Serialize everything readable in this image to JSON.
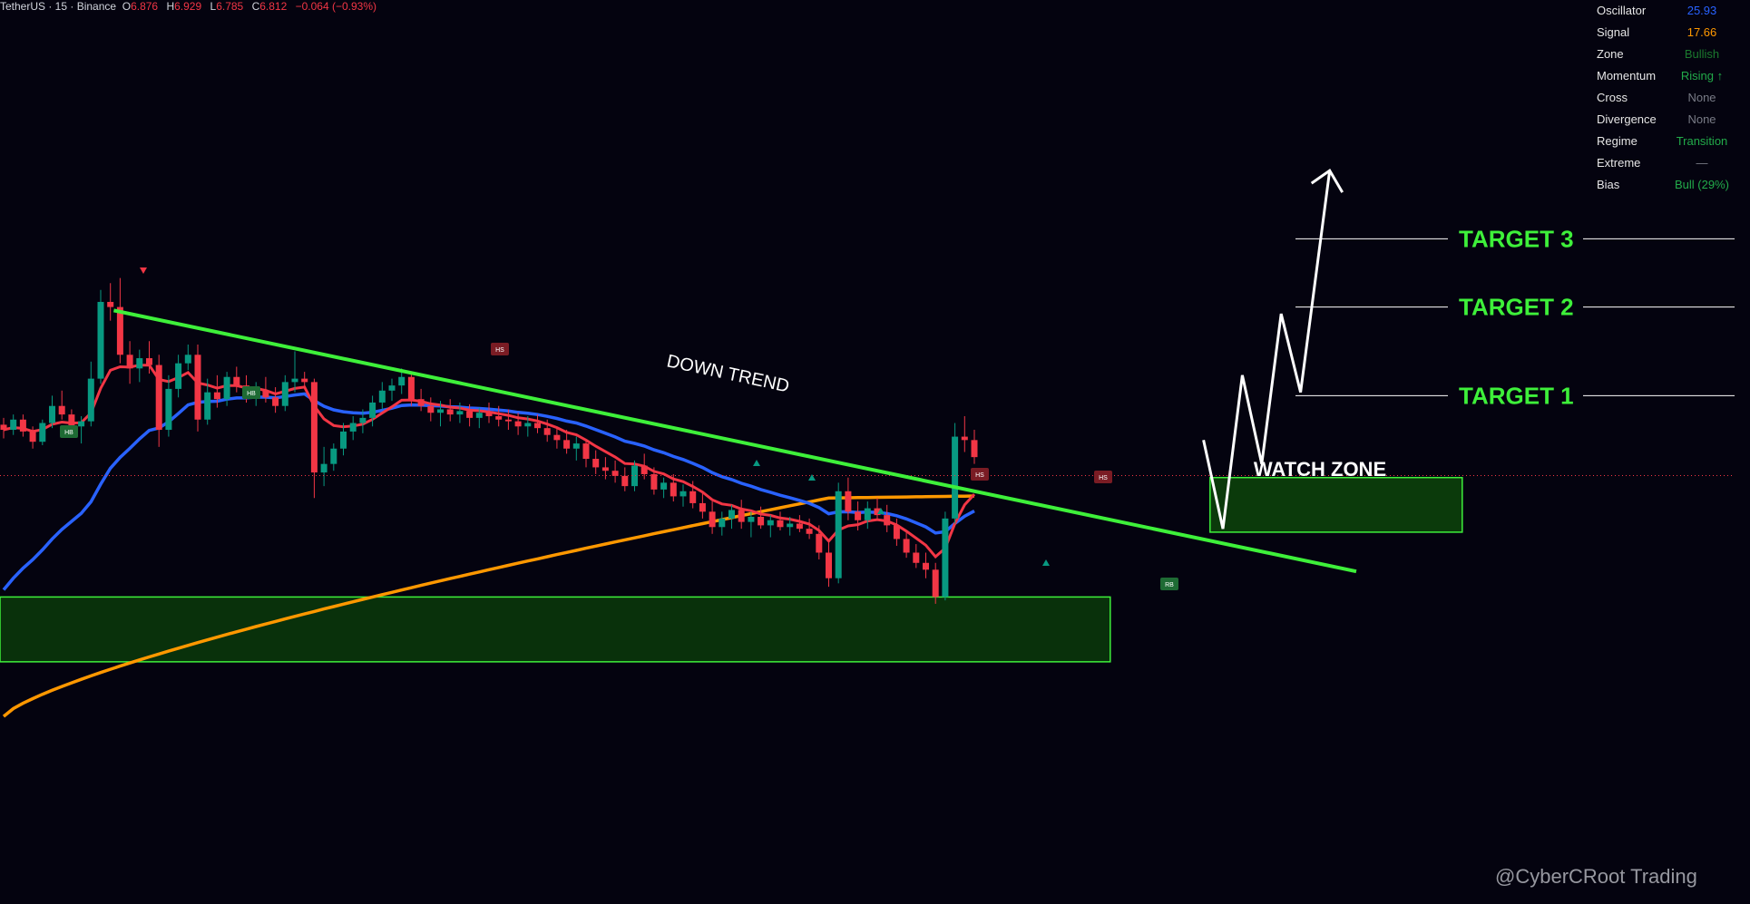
{
  "header": {
    "symbol": "TetherUS · 15 · Binance",
    "open_label": "O",
    "open": "6.876",
    "high_label": "H",
    "high": "6.929",
    "low_label": "L",
    "low": "6.785",
    "close_label": "C",
    "close": "6.812",
    "change": "−0.064 (−0.93%)"
  },
  "panel": [
    {
      "label": "Oscillator",
      "value": "25.93",
      "color": "#2962ff"
    },
    {
      "label": "Signal",
      "value": "17.66",
      "color": "#ff9800"
    },
    {
      "label": "Zone",
      "value": "Bullish",
      "color": "#1b7a2e"
    },
    {
      "label": "Momentum",
      "value": "Rising ↑",
      "color": "#22ab4a"
    },
    {
      "label": "Cross",
      "value": "None",
      "color": "#787b86"
    },
    {
      "label": "Divergence",
      "value": "None",
      "color": "#787b86"
    },
    {
      "label": "Regime",
      "value": "Transition",
      "color": "#22ab4a"
    },
    {
      "label": "Extreme",
      "value": "—",
      "color": "#787b86"
    },
    {
      "label": "Bias",
      "value": "Bull (29%)",
      "color": "#22ab4a"
    }
  ],
  "annotations": {
    "trend_label": "DOWN TREND",
    "watch_zone": "WATCH ZONE",
    "target_1": "TARGET 1",
    "target_2": "TARGET 2",
    "target_3": "TARGET 3",
    "hs_marker": "HS",
    "hb_marker": "HB",
    "rb_marker": "RB"
  },
  "watermark": "@CyberCRoot Trading",
  "colors": {
    "bg": "#04030f",
    "bull": "#089981",
    "bear": "#f23645",
    "trendline": "#3ef03a",
    "zone_fill": "#0b3a0b",
    "zone_border": "#3ef03a",
    "target_text": "#3ef03a",
    "ema_fast": "#f23645",
    "ema_mid": "#2962ff",
    "ema_slow": "#ff9800",
    "projection": "#ffffff"
  },
  "chart_data": {
    "type": "candlestick",
    "timeframe": "15",
    "exchange": "Binance",
    "ylim": [
      4.3,
      9.6
    ],
    "current_price": 6.812,
    "ohlc": [
      [
        7.11,
        7.15,
        7.03,
        7.08
      ],
      [
        7.08,
        7.17,
        7.05,
        7.14
      ],
      [
        7.14,
        7.17,
        7.04,
        7.07
      ],
      [
        7.07,
        7.1,
        6.97,
        7.01
      ],
      [
        7.01,
        7.14,
        6.99,
        7.12
      ],
      [
        7.12,
        7.28,
        7.09,
        7.22
      ],
      [
        7.22,
        7.31,
        7.14,
        7.17
      ],
      [
        7.17,
        7.2,
        7.07,
        7.1
      ],
      [
        7.1,
        7.16,
        7.0,
        7.13
      ],
      [
        7.13,
        7.48,
        7.1,
        7.38
      ],
      [
        7.38,
        7.9,
        7.35,
        7.83
      ],
      [
        7.83,
        7.94,
        7.72,
        7.8
      ],
      [
        7.8,
        7.97,
        7.47,
        7.52
      ],
      [
        7.52,
        7.6,
        7.35,
        7.44
      ],
      [
        7.44,
        7.55,
        7.36,
        7.5
      ],
      [
        7.5,
        7.6,
        7.41,
        7.46
      ],
      [
        7.46,
        7.52,
        6.98,
        7.08
      ],
      [
        7.08,
        7.4,
        7.04,
        7.32
      ],
      [
        7.32,
        7.52,
        7.27,
        7.47
      ],
      [
        7.47,
        7.58,
        7.43,
        7.52
      ],
      [
        7.52,
        7.58,
        7.07,
        7.14
      ],
      [
        7.14,
        7.38,
        7.11,
        7.3
      ],
      [
        7.3,
        7.4,
        7.21,
        7.26
      ],
      [
        7.26,
        7.42,
        7.22,
        7.39
      ],
      [
        7.39,
        7.45,
        7.3,
        7.34
      ],
      [
        7.34,
        7.4,
        7.24,
        7.28
      ],
      [
        7.28,
        7.36,
        7.22,
        7.31
      ],
      [
        7.31,
        7.39,
        7.24,
        7.27
      ],
      [
        7.27,
        7.33,
        7.18,
        7.22
      ],
      [
        7.22,
        7.4,
        7.19,
        7.36
      ],
      [
        7.36,
        7.54,
        7.3,
        7.38
      ],
      [
        7.38,
        7.42,
        7.33,
        7.36
      ],
      [
        7.36,
        7.38,
        6.68,
        6.83
      ],
      [
        6.83,
        6.98,
        6.75,
        6.88
      ],
      [
        6.88,
        7.0,
        6.84,
        6.97
      ],
      [
        6.97,
        7.12,
        6.93,
        7.07
      ],
      [
        7.07,
        7.16,
        7.02,
        7.12
      ],
      [
        7.12,
        7.2,
        7.06,
        7.15
      ],
      [
        7.15,
        7.28,
        7.1,
        7.24
      ],
      [
        7.24,
        7.36,
        7.2,
        7.31
      ],
      [
        7.31,
        7.38,
        7.25,
        7.34
      ],
      [
        7.34,
        7.44,
        7.29,
        7.39
      ],
      [
        7.39,
        7.42,
        7.22,
        7.26
      ],
      [
        7.26,
        7.32,
        7.19,
        7.22
      ],
      [
        7.22,
        7.27,
        7.13,
        7.18
      ],
      [
        7.18,
        7.25,
        7.1,
        7.2
      ],
      [
        7.2,
        7.26,
        7.13,
        7.17
      ],
      [
        7.17,
        7.24,
        7.12,
        7.19
      ],
      [
        7.19,
        7.23,
        7.1,
        7.15
      ],
      [
        7.15,
        7.21,
        7.09,
        7.18
      ],
      [
        7.18,
        7.24,
        7.12,
        7.16
      ],
      [
        7.16,
        7.22,
        7.1,
        7.14
      ],
      [
        7.14,
        7.2,
        7.08,
        7.13
      ],
      [
        7.13,
        7.18,
        7.05,
        7.1
      ],
      [
        7.1,
        7.16,
        7.04,
        7.12
      ],
      [
        7.12,
        7.17,
        7.06,
        7.09
      ],
      [
        7.09,
        7.14,
        7.01,
        7.05
      ],
      [
        7.05,
        7.1,
        6.97,
        7.02
      ],
      [
        7.02,
        7.08,
        6.94,
        6.97
      ],
      [
        6.97,
        7.04,
        6.9,
        7.0
      ],
      [
        7.0,
        7.02,
        6.86,
        6.91
      ],
      [
        6.91,
        6.96,
        6.82,
        6.86
      ],
      [
        6.86,
        6.92,
        6.79,
        6.84
      ],
      [
        6.84,
        6.9,
        6.77,
        6.81
      ],
      [
        6.81,
        6.86,
        6.72,
        6.75
      ],
      [
        6.75,
        6.9,
        6.72,
        6.87
      ],
      [
        6.87,
        6.94,
        6.79,
        6.82
      ],
      [
        6.82,
        6.86,
        6.7,
        6.73
      ],
      [
        6.73,
        6.8,
        6.68,
        6.77
      ],
      [
        6.77,
        6.82,
        6.66,
        6.69
      ],
      [
        6.69,
        6.76,
        6.63,
        6.72
      ],
      [
        6.72,
        6.78,
        6.62,
        6.65
      ],
      [
        6.65,
        6.72,
        6.56,
        6.6
      ],
      [
        6.6,
        6.66,
        6.47,
        6.51
      ],
      [
        6.51,
        6.6,
        6.46,
        6.56
      ],
      [
        6.56,
        6.64,
        6.5,
        6.61
      ],
      [
        6.61,
        6.67,
        6.5,
        6.54
      ],
      [
        6.54,
        6.6,
        6.45,
        6.57
      ],
      [
        6.57,
        6.63,
        6.5,
        6.52
      ],
      [
        6.52,
        6.58,
        6.45,
        6.55
      ],
      [
        6.55,
        6.6,
        6.49,
        6.51
      ],
      [
        6.51,
        6.57,
        6.46,
        6.53
      ],
      [
        6.53,
        6.58,
        6.48,
        6.5
      ],
      [
        6.5,
        6.56,
        6.44,
        6.47
      ],
      [
        6.47,
        6.52,
        6.32,
        6.36
      ],
      [
        6.36,
        6.42,
        6.16,
        6.21
      ],
      [
        6.21,
        6.77,
        6.18,
        6.72
      ],
      [
        6.72,
        6.8,
        6.55,
        6.6
      ],
      [
        6.6,
        6.66,
        6.49,
        6.55
      ],
      [
        6.55,
        6.66,
        6.5,
        6.62
      ],
      [
        6.62,
        6.68,
        6.55,
        6.58
      ],
      [
        6.58,
        6.64,
        6.48,
        6.52
      ],
      [
        6.52,
        6.56,
        6.4,
        6.44
      ],
      [
        6.44,
        6.48,
        6.33,
        6.36
      ],
      [
        6.36,
        6.41,
        6.27,
        6.3
      ],
      [
        6.3,
        6.36,
        6.21,
        6.26
      ],
      [
        6.26,
        6.3,
        6.06,
        6.1
      ],
      [
        6.1,
        6.6,
        6.08,
        6.56
      ],
      [
        6.56,
        7.12,
        6.53,
        7.04
      ],
      [
        7.04,
        7.16,
        6.95,
        7.02
      ],
      [
        7.02,
        7.08,
        6.88,
        6.92
      ]
    ],
    "trendline": {
      "start": [
        2,
        7.78
      ],
      "end": [
        130,
        6.25
      ]
    },
    "support_zone": [
      5.72,
      6.1
    ],
    "watch_zone": [
      6.48,
      6.8
    ],
    "targets": [
      {
        "label": "TARGET 1",
        "price": 7.28
      },
      {
        "label": "TARGET 2",
        "price": 7.8
      },
      {
        "label": "TARGET 3",
        "price": 8.2
      }
    ],
    "projection": [
      [
        118,
        7.02
      ],
      [
        120,
        6.5
      ],
      [
        122,
        7.4
      ],
      [
        124,
        6.88
      ],
      [
        126,
        7.76
      ],
      [
        128,
        7.3
      ],
      [
        131,
        8.6
      ]
    ]
  }
}
